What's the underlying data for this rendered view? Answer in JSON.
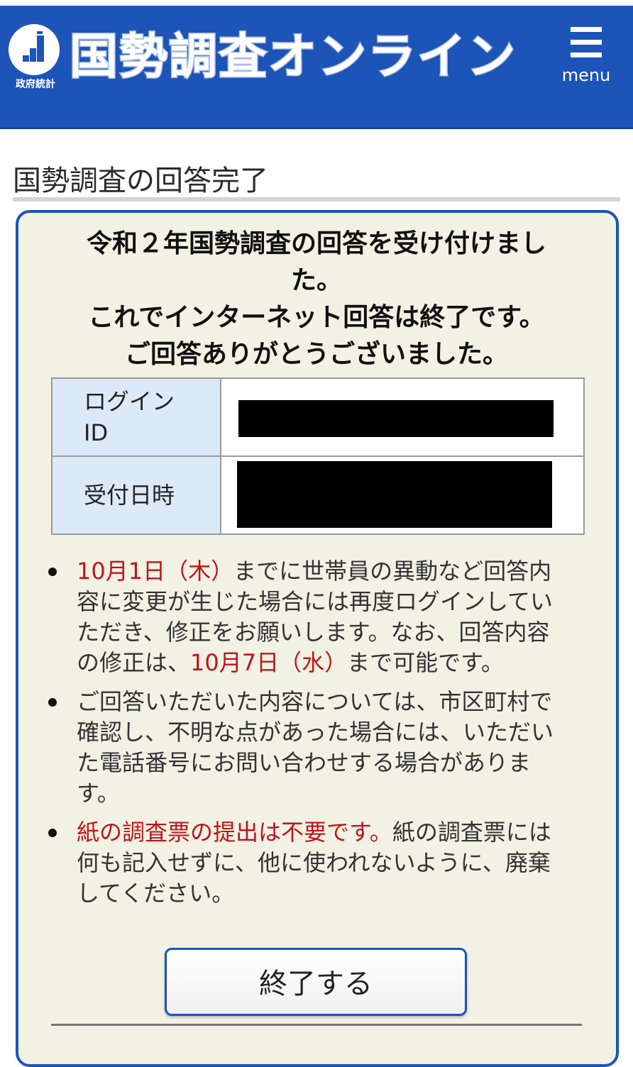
{
  "header": {
    "site_title": "国勢調査オンライン",
    "gov_label": "政府統計",
    "menu_label": "menu",
    "logo_icon": "stats-bar-logo-icon",
    "menu_icon": "hamburger-menu-icon",
    "brand_color": "#1d54b8"
  },
  "page": {
    "title": "国勢調査の回答完了"
  },
  "panel": {
    "headline": [
      "令和２年国勢調査の回答を受け付けまし",
      "た。",
      "これでインターネット回答は終了です。",
      "ご回答ありがとうございました。"
    ],
    "table": {
      "login_id_label": "ログインID",
      "received_label": "受付日時"
    },
    "notes": {
      "n1_red": "10月1日（木）",
      "n1_text_a": "までに世帯員の異動など回答内容に変更が生じた場合には再度ログインしていただき、修正をお願いします。なお、回答内容の修正は、",
      "n1_red2": "10月7日（水）",
      "n1_text_b": "まで可能です。",
      "n2_text": "ご回答いただいた内容については、市区町村で確認し、不明な点があった場合には、いただいた電話番号にお問い合わせする場合があります。",
      "n3_red": "紙の調査票の提出は不要です。",
      "n3_text": "紙の調査票には何も記入せずに、他に使われないように、廃棄してください。"
    },
    "finish_button": "終了する",
    "accent_red": "#c0141b"
  }
}
